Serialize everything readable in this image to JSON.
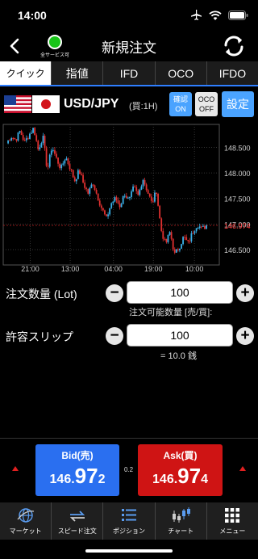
{
  "status_bar": {
    "time": "14:00"
  },
  "header": {
    "title": "新規注文",
    "service_status": "全サービス可"
  },
  "tabs": [
    {
      "label": "クイック",
      "active": true
    },
    {
      "label": "指値",
      "active": false
    },
    {
      "label": "IFD",
      "active": false
    },
    {
      "label": "OCO",
      "active": false
    },
    {
      "label": "IFDO",
      "active": false
    }
  ],
  "pair": {
    "name": "USD/JPY",
    "timeframe": "(買:1H)",
    "confirm_button": {
      "line1": "確認",
      "line2": "ON"
    },
    "oco_button": {
      "line1": "OCO",
      "line2": "OFF"
    },
    "settings_button": "設定"
  },
  "chart_data": {
    "type": "candlestick",
    "x_tick_labels": [
      "21:00",
      "13:00",
      "04:00",
      "19:00",
      "10:00"
    ],
    "y_tick_labels": [
      "148.500",
      "148.000",
      "147.500",
      "147.000",
      "146.500"
    ],
    "y_ticks": [
      148.5,
      148.0,
      147.5,
      147.0,
      146.5
    ],
    "ylim": [
      146.2,
      148.95
    ],
    "current_price_label": "146.974",
    "current_price": 146.974,
    "grid": true,
    "up_color": "#3ab0e8",
    "down_color": "#e03030",
    "path": [
      148.58,
      148.72,
      148.65,
      148.82,
      148.6,
      148.75,
      148.88,
      148.45,
      148.72,
      148.05,
      148.52,
      148.28,
      148.08,
      148.32,
      148.1,
      147.85,
      148.05,
      147.78,
      147.6,
      147.82,
      147.55,
      147.3,
      147.1,
      147.4,
      147.5,
      147.35,
      147.6,
      147.45,
      147.72,
      147.55,
      147.9,
      147.65,
      147.4,
      147.65,
      146.9,
      146.6,
      146.85,
      146.4,
      146.55,
      146.75,
      146.62,
      146.85,
      147.0,
      146.9,
      146.974
    ]
  },
  "order": {
    "quantity_label": "注文数量 (Lot)",
    "quantity_value": "100",
    "available_label": "注文可能数量 [売/買]:",
    "slippage_label": "許容スリップ",
    "slippage_value": "100",
    "slippage_note": "= 10.0 銭"
  },
  "trade": {
    "bid_label": "Bid(売)",
    "bid_prefix": "146.",
    "bid_big": "97",
    "bid_small": "2",
    "ask_label": "Ask(買)",
    "ask_prefix": "146.",
    "ask_big": "97",
    "ask_small": "4",
    "spread": "0.2"
  },
  "bottom_nav": [
    {
      "label": "マーケット",
      "icon": "globe-icon"
    },
    {
      "label": "スピード注文",
      "icon": "speed-arrows-icon"
    },
    {
      "label": "ポジション",
      "icon": "list-icon"
    },
    {
      "label": "チャート",
      "icon": "candle-chart-icon"
    },
    {
      "label": "メニュー",
      "icon": "grid-menu-icon"
    }
  ],
  "colors": {
    "accent_blue": "#2a6ff0",
    "ask_red": "#cf1414",
    "service_green": "#18c418"
  }
}
